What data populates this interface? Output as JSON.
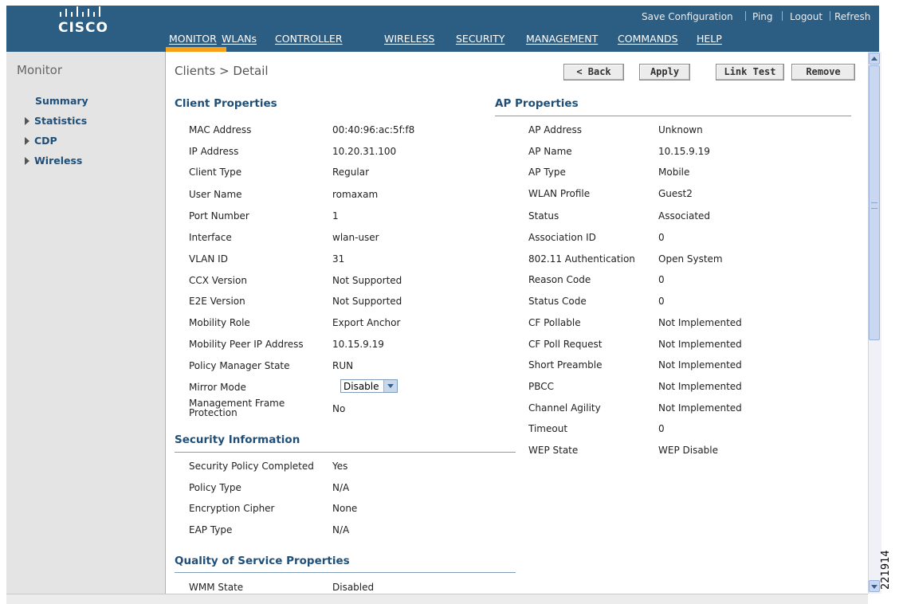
{
  "header": {
    "logo_text": "CISCO",
    "menu": [
      "MONITOR",
      "WLANs",
      "CONTROLLER",
      "WIRELESS",
      "SECURITY",
      "MANAGEMENT",
      "COMMANDS",
      "HELP"
    ],
    "active_menu": "MONITOR",
    "links": [
      "Save Configuration",
      "Ping",
      "Logout",
      "Refresh"
    ]
  },
  "sidebar": {
    "title": "Monitor",
    "items": [
      "Summary",
      "Statistics",
      "CDP",
      "Wireless"
    ]
  },
  "page": {
    "title": "Clients > Detail",
    "buttons": [
      "< Back",
      "Apply",
      "Link Test",
      "Remove"
    ]
  },
  "client_properties": {
    "heading": "Client Properties",
    "rows": [
      {
        "label": "MAC Address",
        "value": "00:40:96:ac:5f:f8"
      },
      {
        "label": "IP Address",
        "value": "10.20.31.100"
      },
      {
        "label": "Client Type",
        "value": "Regular"
      },
      {
        "label": "User Name",
        "value": "romaxam"
      },
      {
        "label": "Port Number",
        "value": "1"
      },
      {
        "label": "Interface",
        "value": "wlan-user"
      },
      {
        "label": "VLAN ID",
        "value": "31"
      },
      {
        "label": "CCX Version",
        "value": "Not Supported"
      },
      {
        "label": "E2E Version",
        "value": "Not Supported"
      },
      {
        "label": "Mobility Role",
        "value": "Export Anchor"
      },
      {
        "label": "Mobility Peer IP Address",
        "value": "10.15.9.19"
      },
      {
        "label": "Policy Manager State",
        "value": "RUN"
      },
      {
        "label": "Mirror Mode",
        "value": "Disable"
      },
      {
        "label": "Management Frame Protection",
        "value": "No"
      }
    ]
  },
  "security_information": {
    "heading": "Security Information",
    "rows": [
      {
        "label": "Security Policy Completed",
        "value": "Yes"
      },
      {
        "label": "Policy Type",
        "value": "N/A"
      },
      {
        "label": "Encryption Cipher",
        "value": "None"
      },
      {
        "label": "EAP Type",
        "value": "N/A"
      }
    ]
  },
  "qos_properties": {
    "heading": "Quality of Service Properties",
    "rows": [
      {
        "label": "WMM State",
        "value": "Disabled"
      }
    ]
  },
  "ap_properties": {
    "heading": "AP Properties",
    "rows": [
      {
        "label": "AP Address",
        "value": "Unknown"
      },
      {
        "label": "AP Name",
        "value": "10.15.9.19"
      },
      {
        "label": "AP Type",
        "value": "Mobile"
      },
      {
        "label": "WLAN Profile",
        "value": "Guest2"
      },
      {
        "label": "Status",
        "value": "Associated"
      },
      {
        "label": "Association ID",
        "value": "0"
      },
      {
        "label": "802.11 Authentication",
        "value": "Open System"
      },
      {
        "label": "Reason Code",
        "value": "0"
      },
      {
        "label": "Status Code",
        "value": "0"
      },
      {
        "label": "CF Pollable",
        "value": "Not Implemented"
      },
      {
        "label": "CF Poll Request",
        "value": "Not Implemented"
      },
      {
        "label": "Short Preamble",
        "value": "Not Implemented"
      },
      {
        "label": "PBCC",
        "value": "Not Implemented"
      },
      {
        "label": "Channel Agility",
        "value": "Not Implemented"
      },
      {
        "label": "Timeout",
        "value": "0"
      },
      {
        "label": "WEP State",
        "value": "WEP Disable"
      }
    ]
  },
  "figure_id": "221914",
  "colors": {
    "header_bg": "#2c5d82",
    "active_indicator": "#f7a11a",
    "section_heading": "#1f4f78",
    "sidebar_bg": "#e4e4e4"
  }
}
